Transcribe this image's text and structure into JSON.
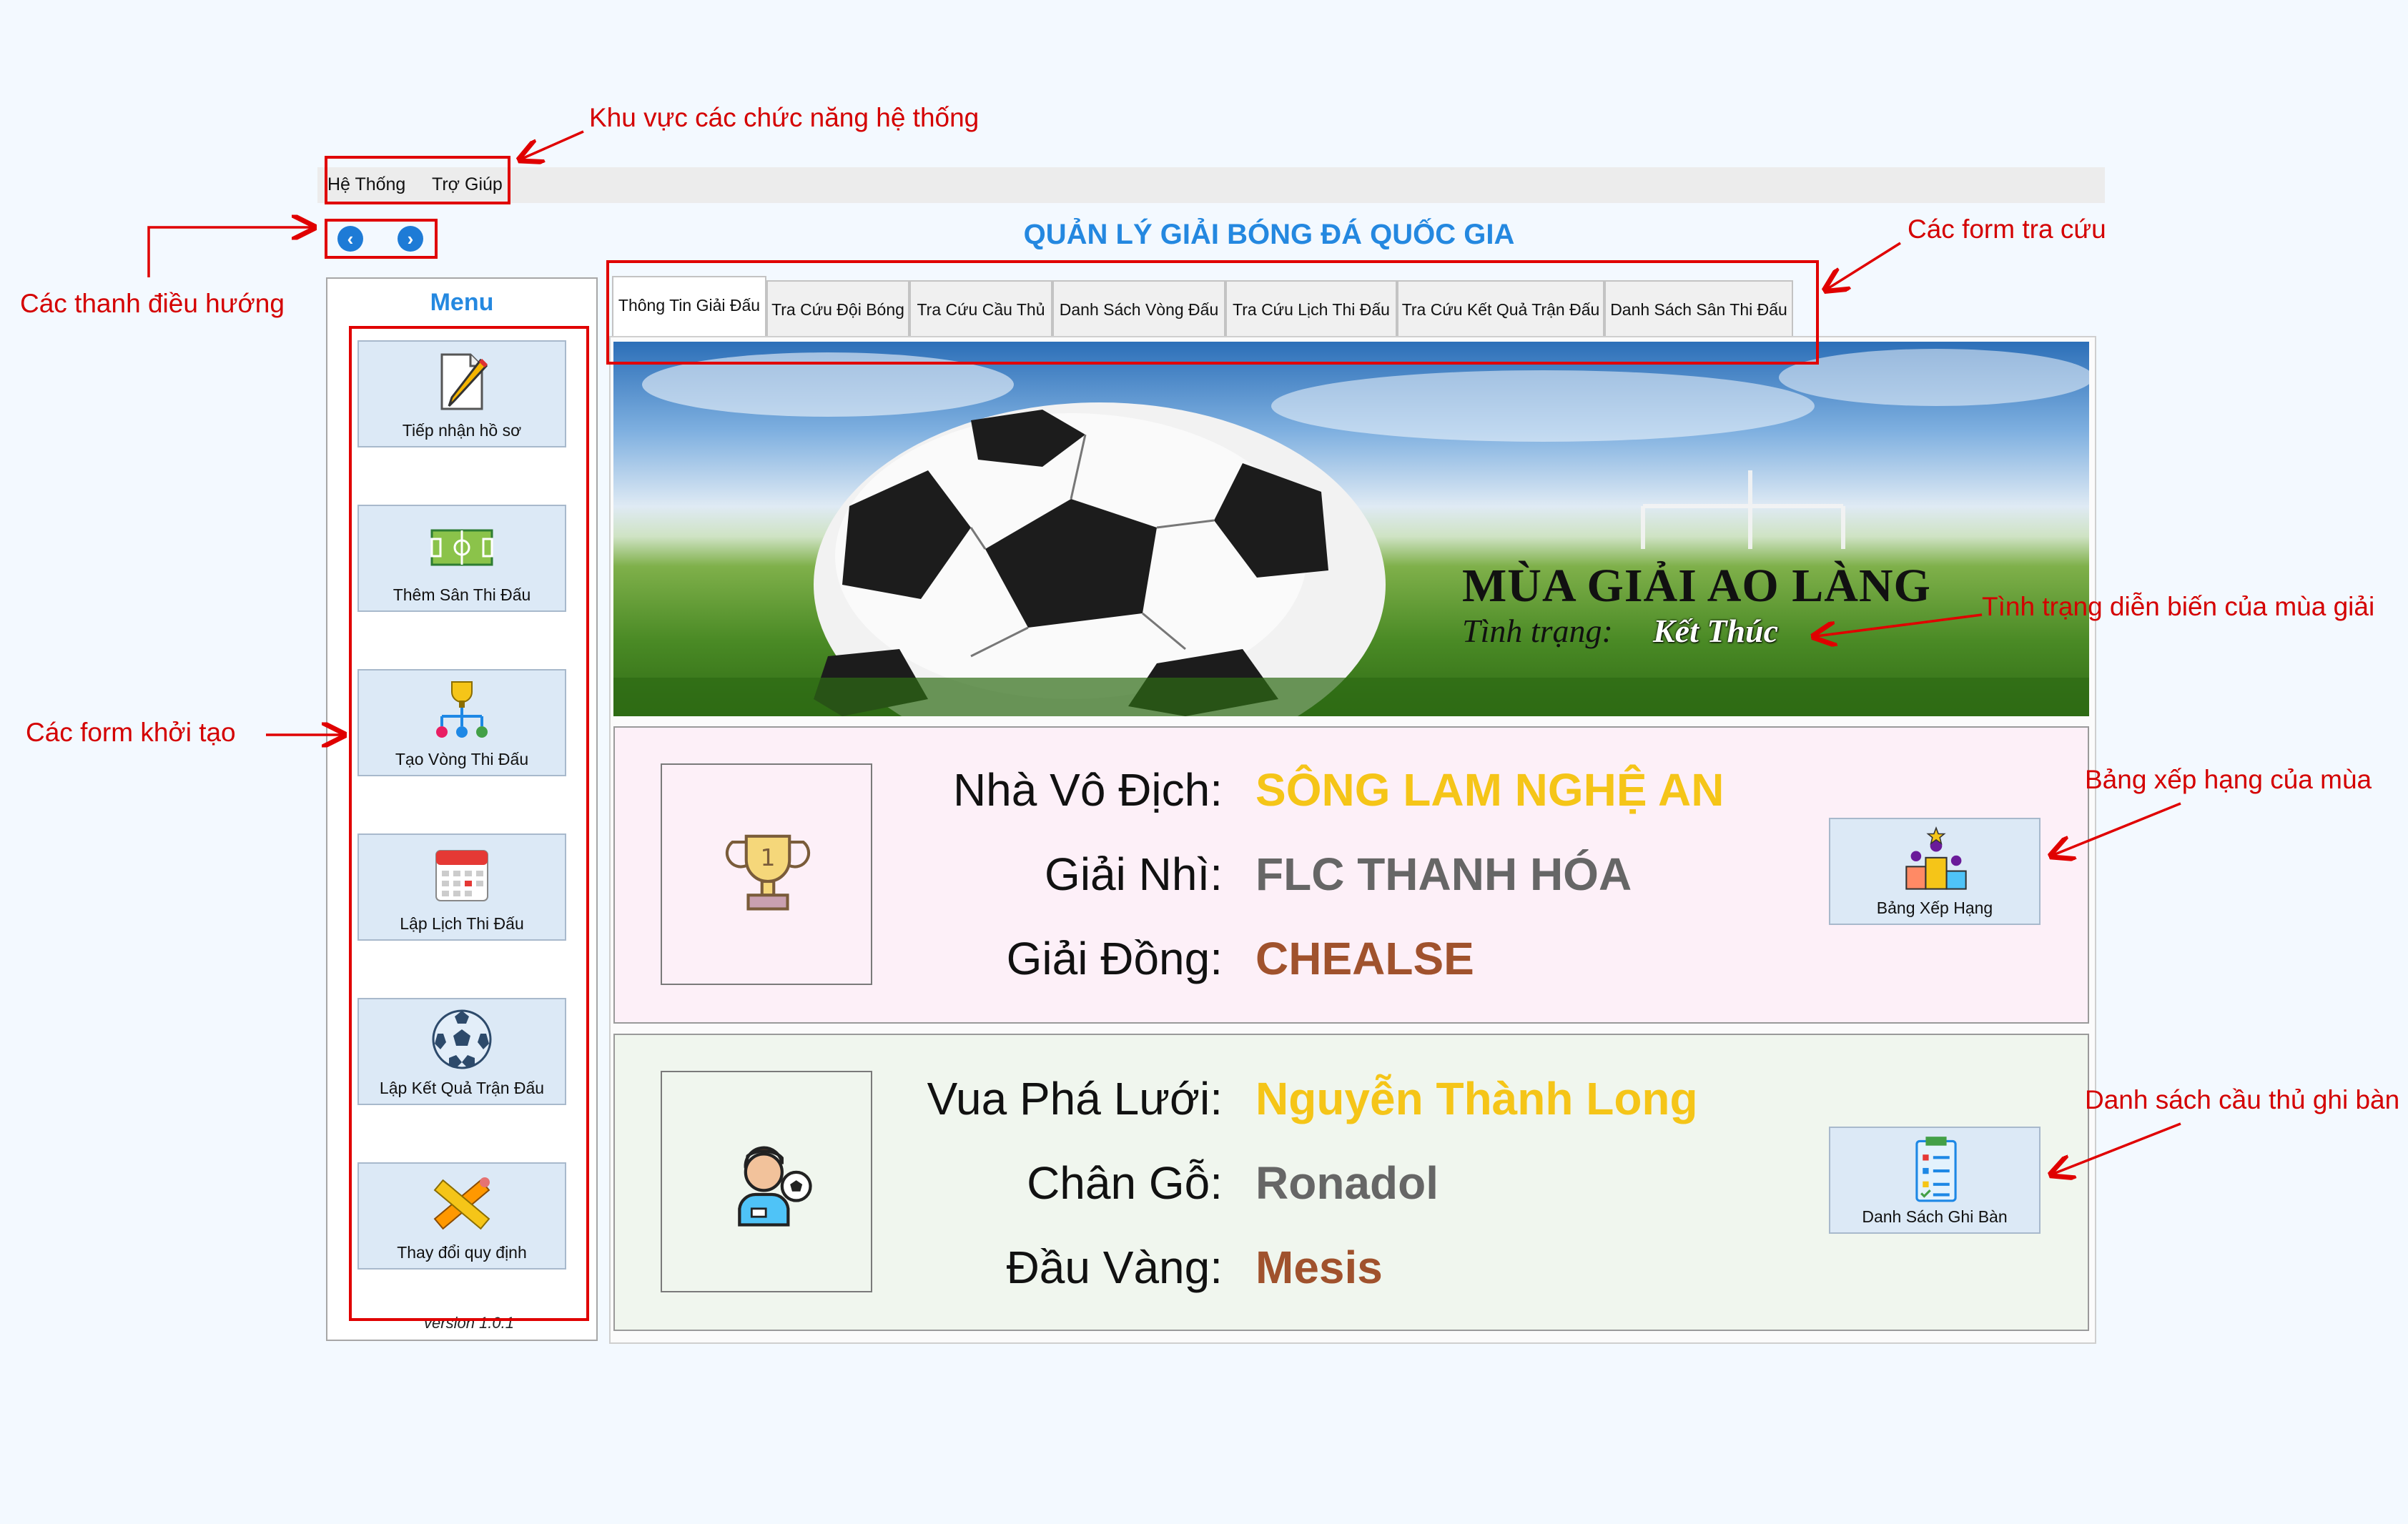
{
  "menubar": {
    "items": [
      "Hệ Thống",
      "Trợ Giúp"
    ]
  },
  "app_title": "QUẢN LÝ GIẢI BÓNG ĐÁ QUỐC GIA",
  "sidebar": {
    "title": "Menu",
    "items": [
      {
        "label": "Tiếp nhận hồ sơ",
        "icon": "pencil-note-icon"
      },
      {
        "label": "Thêm Sân Thi Đấu",
        "icon": "soccer-field-icon"
      },
      {
        "label": "Tạo Vòng Thi Đấu",
        "icon": "tournament-bracket-icon"
      },
      {
        "label": "Lập Lịch Thi Đấu",
        "icon": "calendar-icon"
      },
      {
        "label": "Lập Kết Quả Trận Đấu",
        "icon": "soccer-ball-icon"
      },
      {
        "label": "Thay đổi quy định",
        "icon": "pencil-ruler-icon"
      }
    ],
    "version": "version 1.0.1"
  },
  "tabs": [
    "Thông Tin Giải Đấu",
    "Tra Cứu Đội Bóng",
    "Tra Cứu Cầu Thủ",
    "Danh Sách Vòng Đấu",
    "Tra Cứu Lịch Thi Đấu",
    "Tra Cứu Kết Quả Trận Đấu",
    "Danh Sách Sân Thi Đấu"
  ],
  "banner": {
    "title": "MÙA GIẢI AO LÀNG",
    "status_label": "Tình trạng:",
    "status_value": "Kết Thúc"
  },
  "ranking": {
    "rows": [
      {
        "label": "Nhà Vô Địch:",
        "value": "SÔNG LAM NGHỆ AN"
      },
      {
        "label": "Giải Nhì:",
        "value": "FLC THANH HÓA"
      },
      {
        "label": "Giải Đồng:",
        "value": "CHEALSE"
      }
    ],
    "button_label": "Bảng Xếp Hạng"
  },
  "scorers": {
    "rows": [
      {
        "label": "Vua Phá Lưới:",
        "value": "Nguyễn Thành Long"
      },
      {
        "label": "Chân Gỗ:",
        "value": "Ronadol"
      },
      {
        "label": "Đầu Vàng:",
        "value": "Mesis"
      }
    ],
    "button_label": "Danh Sách Ghi Bàn"
  },
  "annotations": {
    "system_area": "Khu vực các chức năng hệ thống",
    "navigation": "Các thanh điều hướng",
    "lookup_forms": "Các form tra cứu",
    "init_forms": "Các form khởi tạo",
    "season_status": "Tình trạng diễn biến của mùa giải",
    "season_ranking": "Bảng xếp hạng của mùa",
    "scorer_list": "Danh sách cầu thủ ghi bàn"
  },
  "colors": {
    "accent": "#2488e0",
    "gold": "#f5c518",
    "silver": "#666666",
    "bronze": "#a0522d",
    "annotation": "#d40000"
  }
}
